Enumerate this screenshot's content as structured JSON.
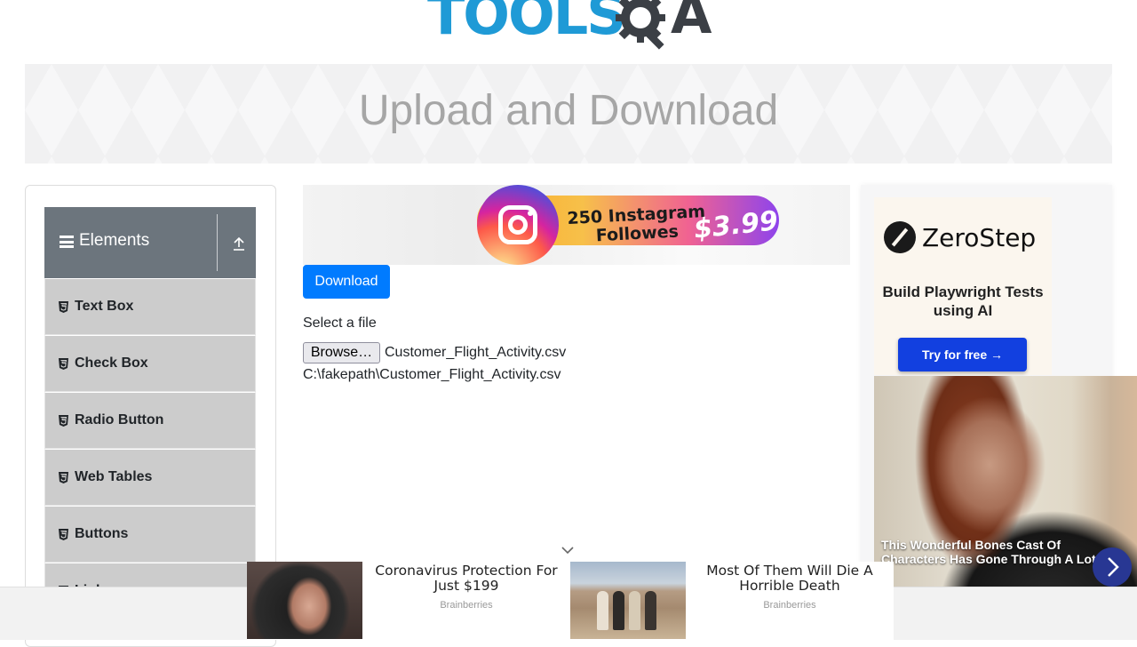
{
  "header": {
    "logo_text": "TOOLS",
    "logo_letter": "A",
    "logo_alt": "ToolsQA"
  },
  "banner": {
    "title": "Upload and Download"
  },
  "sidebar": {
    "group_title": "Elements",
    "items": [
      {
        "label": "Text Box"
      },
      {
        "label": "Check Box"
      },
      {
        "label": "Radio Button"
      },
      {
        "label": "Web Tables"
      },
      {
        "label": "Buttons"
      },
      {
        "label": "Links"
      }
    ]
  },
  "ad_top": {
    "line1": "250 Instagram",
    "line2": "Followes",
    "price": "$3.99"
  },
  "main": {
    "download_label": "Download",
    "select_label": "Select a file",
    "browse_label": "Browse…",
    "file_name": "Customer_Flight_Activity.csv",
    "uploaded_path": "C:\\fakepath\\Customer_Flight_Activity.csv"
  },
  "right_ad": {
    "brand": "ZeroStep",
    "tagline": "Build Playwright Tests using AI",
    "cta": "Try for free →"
  },
  "video_ad": {
    "caption": "This Wonderful Bones Cast Of Characters Has Gone Through A Lot"
  },
  "bottom_ads": [
    {
      "headline": "Coronavirus Protection For Just $199",
      "source": "Brainberries"
    },
    {
      "headline": "Most Of Them Will Die A Horrible Death",
      "source": "Brainberries"
    }
  ],
  "colors": {
    "primary": "#007bff",
    "sidebar_header": "#6c757d",
    "menu_item_bg": "#cccccc",
    "logo_blue": "#1f9ad6",
    "zerostep_cta": "#1240e0"
  }
}
